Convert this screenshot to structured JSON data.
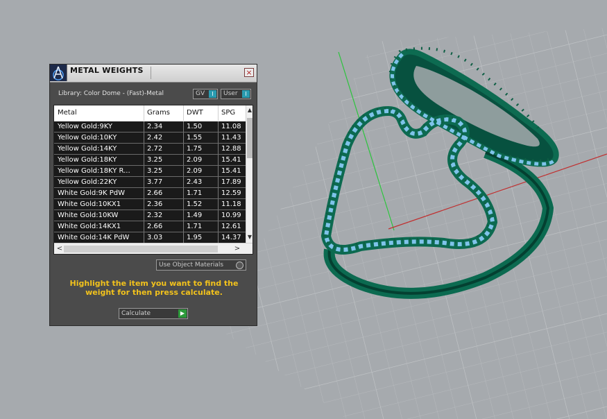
{
  "window": {
    "title": "METAL WEIGHTS",
    "close_icon": "×"
  },
  "library_label": "Library: Color Dome - (Fast)-Metal",
  "toggles": {
    "gv": "GV",
    "user": "User",
    "knob": "I"
  },
  "table": {
    "headers": [
      "Metal",
      "Grams",
      "DWT",
      "SPG"
    ],
    "rows": [
      [
        "Yellow Gold:9KY",
        "2.34",
        "1.50",
        "11.08"
      ],
      [
        "Yellow Gold:10KY",
        "2.42",
        "1.55",
        "11.43"
      ],
      [
        "Yellow Gold:14KY",
        "2.72",
        "1.75",
        "12.88"
      ],
      [
        "Yellow Gold:18KY",
        "3.25",
        "2.09",
        "15.41"
      ],
      [
        "Yellow Gold:18KY R...",
        "3.25",
        "2.09",
        "15.41"
      ],
      [
        "Yellow Gold:22KY",
        "3.77",
        "2.43",
        "17.89"
      ],
      [
        "White Gold:9K PdW",
        "2.66",
        "1.71",
        "12.59"
      ],
      [
        "White Gold:10KX1",
        "2.36",
        "1.52",
        "11.18"
      ],
      [
        "White Gold:10KW",
        "2.32",
        "1.49",
        "10.99"
      ],
      [
        "White Gold:14KX1",
        "2.66",
        "1.71",
        "12.61"
      ],
      [
        "White Gold:14K PdW",
        "3.03",
        "1.95",
        "14.37"
      ]
    ]
  },
  "use_object_materials": "Use Object Materials",
  "instruction": "Highlight the item you want to find the weight for then press calculate.",
  "calculate_label": "Calculate",
  "colors": {
    "accent": "#2a9bb0",
    "instruction": "#f2c21c",
    "ring": "#0a5a45",
    "stones": "#7ec3ea"
  }
}
